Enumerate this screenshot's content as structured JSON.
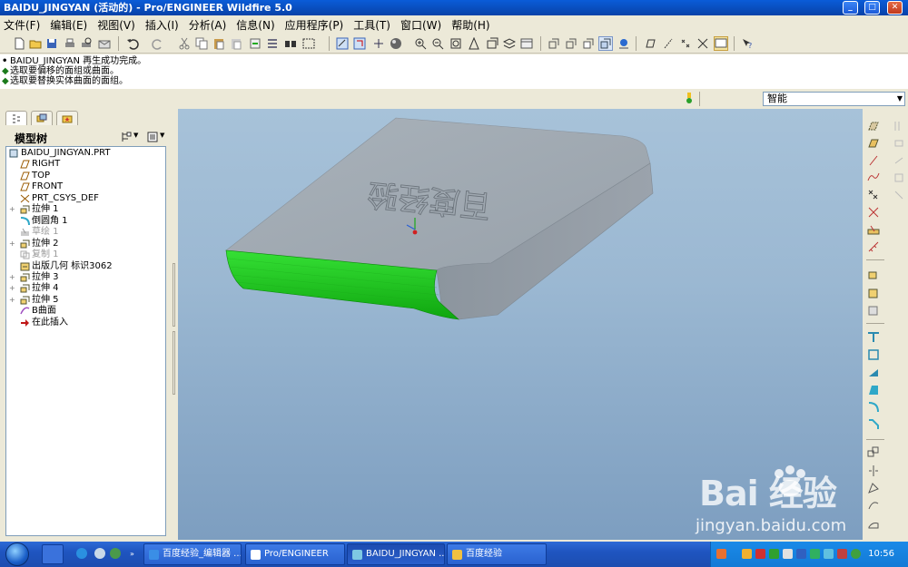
{
  "window": {
    "title": "BAIDU_JINGYAN (活动的) - Pro/ENGINEER Wildfire 5.0"
  },
  "menu": [
    "文件(F)",
    "编辑(E)",
    "视图(V)",
    "插入(I)",
    "分析(A)",
    "信息(N)",
    "应用程序(P)",
    "工具(T)",
    "窗口(W)",
    "帮助(H)"
  ],
  "messages": [
    {
      "text": "BAIDU_JINGYAN 再生成功完成。"
    },
    {
      "text": "选取要偏移的面组或曲面。"
    },
    {
      "text": "选取要替换实体曲面的面组。"
    }
  ],
  "filter": {
    "selected": "智能"
  },
  "model_tree": {
    "title": "模型树",
    "items": [
      {
        "label": "BAIDU_JINGYAN.PRT",
        "icon": "part-icon",
        "expand": "",
        "dim": false,
        "indent": 0
      },
      {
        "label": "RIGHT",
        "icon": "datum-plane-icon",
        "expand": "",
        "dim": false,
        "indent": 1
      },
      {
        "label": "TOP",
        "icon": "datum-plane-icon",
        "expand": "",
        "dim": false,
        "indent": 1
      },
      {
        "label": "FRONT",
        "icon": "datum-plane-icon",
        "expand": "",
        "dim": false,
        "indent": 1
      },
      {
        "label": "PRT_CSYS_DEF",
        "icon": "csys-icon",
        "expand": "",
        "dim": false,
        "indent": 1
      },
      {
        "label": "拉伸 1",
        "icon": "extrude-icon",
        "expand": "+",
        "dim": false,
        "indent": 1
      },
      {
        "label": "倒圆角 1",
        "icon": "round-icon",
        "expand": "",
        "dim": false,
        "indent": 1
      },
      {
        "label": "草绘 1",
        "icon": "sketch-icon",
        "expand": "",
        "dim": true,
        "indent": 1
      },
      {
        "label": "拉伸 2",
        "icon": "extrude-icon",
        "expand": "+",
        "dim": false,
        "indent": 1
      },
      {
        "label": "复制 1",
        "icon": "copy-icon",
        "expand": "",
        "dim": true,
        "indent": 1
      },
      {
        "label": "出版几何 标识3062",
        "icon": "publish-geom-icon",
        "expand": "",
        "dim": false,
        "indent": 1
      },
      {
        "label": "拉伸 3",
        "icon": "extrude-icon",
        "expand": "+",
        "dim": false,
        "indent": 1
      },
      {
        "label": "拉伸 4",
        "icon": "extrude-icon",
        "expand": "+",
        "dim": false,
        "indent": 1
      },
      {
        "label": "拉伸 5",
        "icon": "extrude-icon",
        "expand": "+",
        "dim": false,
        "indent": 1
      },
      {
        "label": "B曲面",
        "icon": "surface-icon",
        "expand": "",
        "dim": false,
        "indent": 1
      },
      {
        "label": "在此插入",
        "icon": "insert-here-arrow-icon",
        "expand": "",
        "dim": false,
        "indent": 1
      }
    ]
  },
  "model": {
    "embossed_text": "百度经验",
    "colors": {
      "body": "#9aa4ad",
      "highlight": "#22d622"
    }
  },
  "watermark": {
    "brand": "Bai 经验",
    "url": "jingyan.baidu.com"
  },
  "taskbar": {
    "tasks": [
      {
        "label": "百度经验_编辑器 ...",
        "icon_color": "#3a8ee6"
      },
      {
        "label": "Pro/ENGINEER",
        "icon_color": "#ffffff"
      },
      {
        "label": "BAIDU_JINGYAN ...",
        "icon_color": "#7ec8e3"
      },
      {
        "label": "百度经验",
        "icon_color": "#f0c040"
      }
    ],
    "clock": "10:56"
  }
}
